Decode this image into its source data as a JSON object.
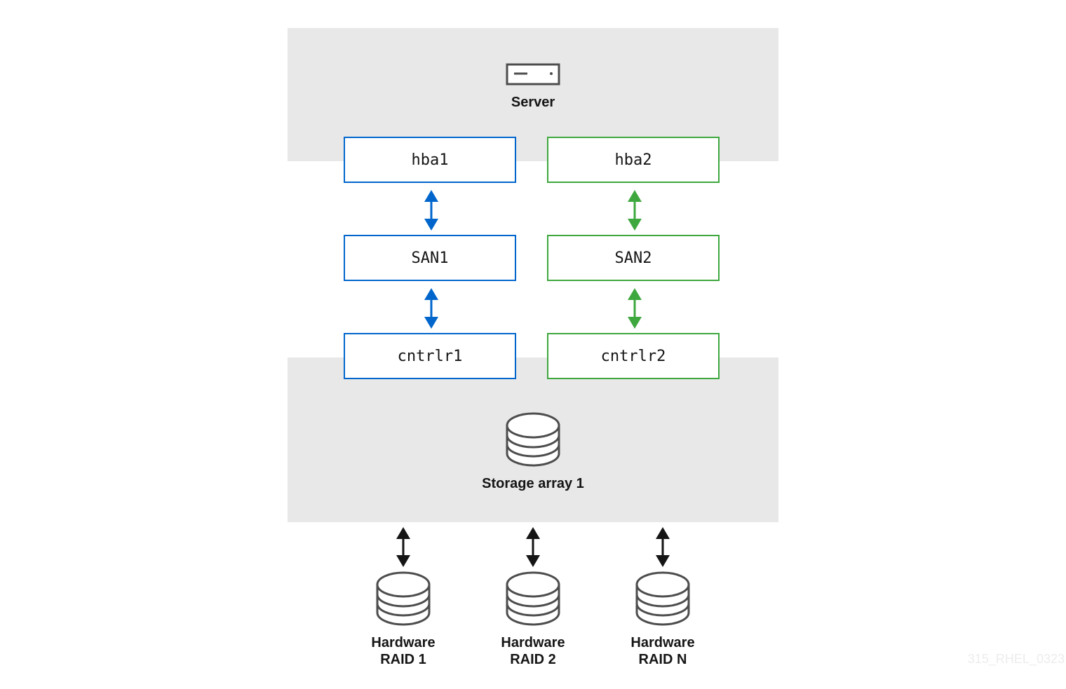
{
  "server": {
    "label": "Server",
    "icon": "server-icon"
  },
  "paths": [
    {
      "color": "#0066cc",
      "nodes": [
        "hba1",
        "SAN1",
        "cntrlr1"
      ]
    },
    {
      "color": "#3ea83e",
      "nodes": [
        "hba2",
        "SAN2",
        "cntrlr2"
      ]
    }
  ],
  "storage": {
    "label": "Storage array 1",
    "icon": "database-icon"
  },
  "raids": [
    {
      "line1": "Hardware",
      "line2": "RAID 1"
    },
    {
      "line1": "Hardware",
      "line2": "RAID 2"
    },
    {
      "line1": "Hardware",
      "line2": "RAID N"
    }
  ],
  "colors": {
    "panel": "#e8e8e8",
    "blue": "#0066cc",
    "green": "#3ea83e",
    "icon": "#4d4d4d",
    "arrow": "#151515"
  },
  "watermark": "315_RHEL_0323"
}
